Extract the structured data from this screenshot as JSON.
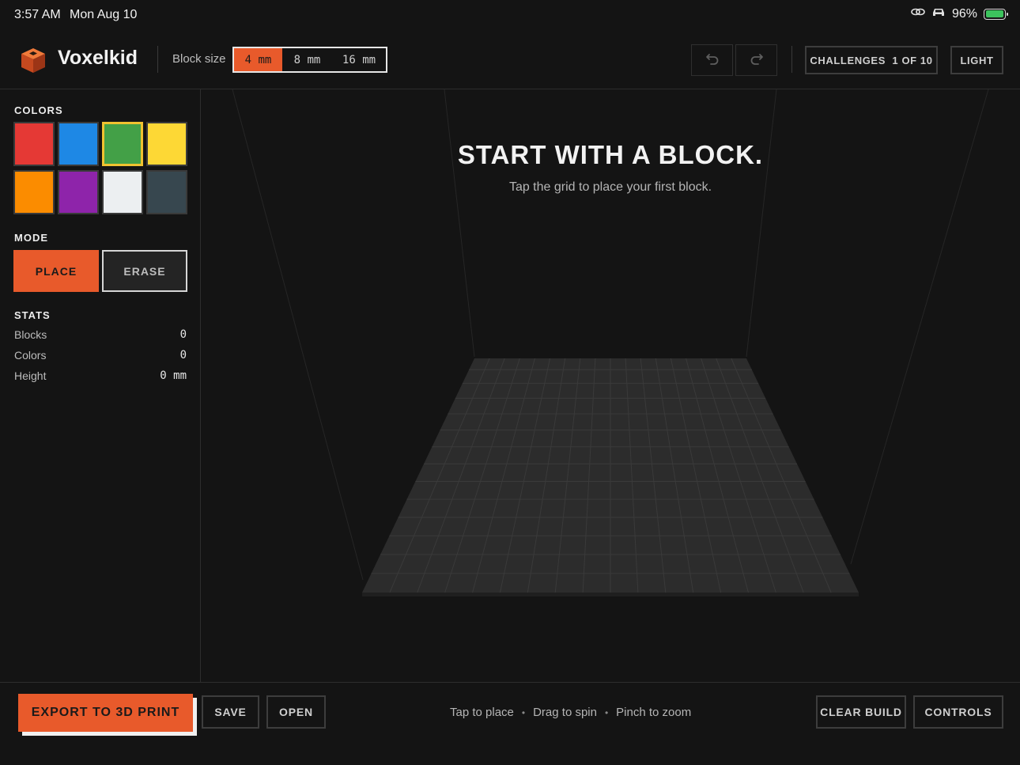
{
  "status": {
    "time": "3:57 AM",
    "date": "Mon Aug 10",
    "battery": "96%",
    "battery_level": 0.96
  },
  "header": {
    "app_name": "Voxelkid",
    "block_size_label": "Block size",
    "block_sizes": [
      "4 mm",
      "8 mm",
      "16 mm"
    ],
    "block_size_selected": "4 mm",
    "challenges": "CHALLENGES",
    "challenges_progress": "1 OF 10",
    "theme": "LIGHT"
  },
  "sidebar": {
    "colors_title": "COLORS",
    "colors": [
      "#e53935",
      "#1e88e5",
      "#43a047",
      "#fdd835",
      "#fb8c00",
      "#8e24aa",
      "#eceff1",
      "#37474f"
    ],
    "selected_color": "#43a047",
    "mode_title": "MODE",
    "mode_place": "PLACE",
    "mode_erase": "ERASE",
    "mode_selected": "PLACE",
    "stats_title": "STATS",
    "stats": [
      {
        "label": "Blocks",
        "value": "0"
      },
      {
        "label": "Colors",
        "value": "0"
      },
      {
        "label": "Height",
        "value": "0 mm"
      }
    ]
  },
  "main": {
    "headline": "START WITH A BLOCK.",
    "subline": "Tap the grid to place your first block."
  },
  "footer": {
    "export": "EXPORT TO 3D PRINT",
    "save": "SAVE",
    "open": "OPEN",
    "hints": [
      "Tap to place",
      "Drag to spin",
      "Pinch to zoom"
    ],
    "clear": "CLEAR BUILD",
    "controls": "CONTROLS"
  },
  "colors": {
    "accent": "#e85a2b",
    "selection": "#f0c230",
    "background": "#141414"
  }
}
